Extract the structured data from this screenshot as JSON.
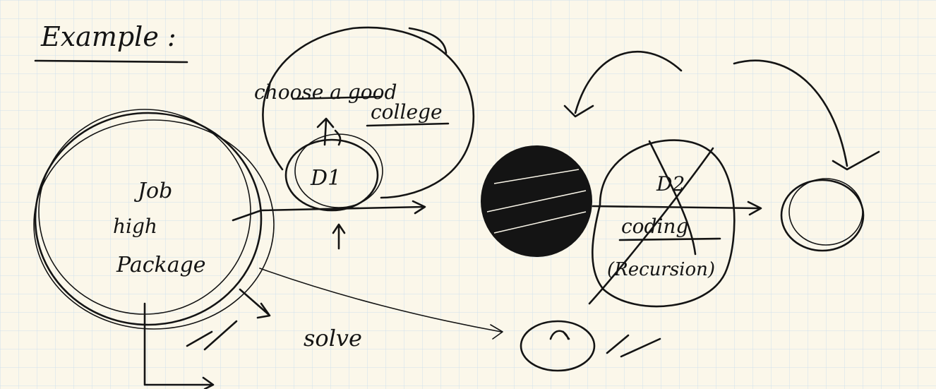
{
  "title": "Example :",
  "labels": {
    "goal": [
      "choose a good",
      "college"
    ],
    "job": [
      "Job",
      "high",
      "Package"
    ],
    "d1": "D1",
    "d2": "D2",
    "coding": [
      "coding",
      "(Recursion)"
    ],
    "solve": "solve"
  },
  "colors": {
    "paper": "#fbf7ea",
    "grid": "#cfe0ee",
    "ink": "#141414"
  }
}
